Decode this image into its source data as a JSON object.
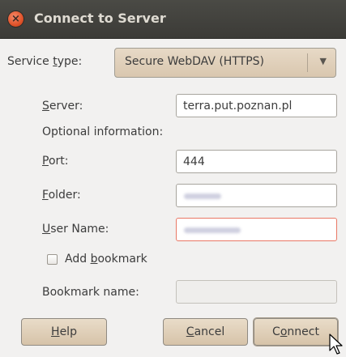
{
  "window": {
    "title": "Connect to Server",
    "close_glyph": "×"
  },
  "service": {
    "label_pre": "Service ",
    "label_mnemonic": "t",
    "label_post": "ype:",
    "selected": "Secure WebDAV (HTTPS)",
    "arrow_glyph": "▼"
  },
  "server": {
    "label_mnemonic": "S",
    "label_post": "erver:",
    "value": "terra.put.poznan.pl"
  },
  "optional_info": "Optional information:",
  "port": {
    "label_mnemonic": "P",
    "label_post": "ort:",
    "value": "444"
  },
  "folder": {
    "label_mnemonic": "F",
    "label_post": "older:"
  },
  "username": {
    "label_mnemonic": "U",
    "label_post": "ser Name:"
  },
  "bookmark": {
    "checkbox_pre": "Add ",
    "checkbox_mnemonic": "b",
    "checkbox_post": "ookmark",
    "checked": false,
    "name_label": "Bookmark name:",
    "name_value": ""
  },
  "buttons": {
    "help_mnemonic": "H",
    "help_post": "elp",
    "cancel_mnemonic": "C",
    "cancel_post": "ancel",
    "connect_pre": "C",
    "connect_mnemonic": "o",
    "connect_post": "nnect"
  },
  "icons": {
    "close": "close-icon",
    "dropdown": "chevron-down-icon",
    "cursor": "mouse-pointer-icon"
  },
  "colors": {
    "titlebar": "#3c3b37",
    "close_button": "#e0532a",
    "button_face": "#d9c7af",
    "focus_border": "#e97865"
  }
}
